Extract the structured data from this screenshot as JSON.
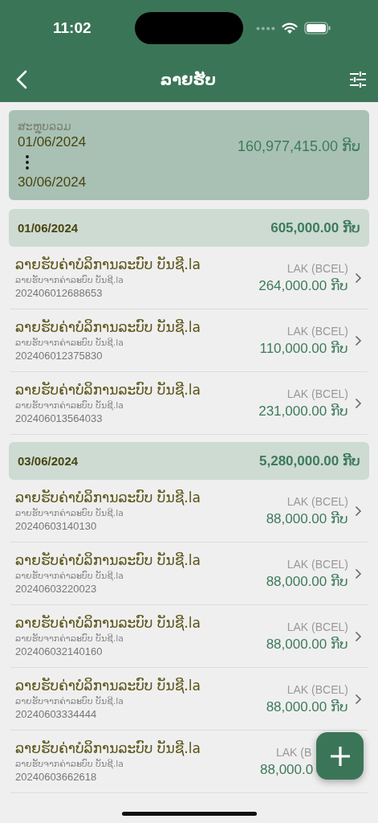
{
  "status_bar": {
    "time": "11:02"
  },
  "nav": {
    "title": "ລາຍຮັບ"
  },
  "summary": {
    "label": "ສະຫຼຸບລວມ",
    "date_from": "01/06/2024",
    "date_to": "30/06/2024",
    "total": "160,977,415.00 ກີບ"
  },
  "groups": [
    {
      "date": "01/06/2024",
      "total": "605,000.00 ກີບ",
      "items": [
        {
          "title": "ລາຍຮັບຄ່າບໍລິການລະບົບ ບັນຊີ.la",
          "subtitle": "ລາຍຮັບຈາກຄ່າລະບົບ ບັນຊີ.la",
          "reference": "202406012688653",
          "currency": "LAK (BCEL)",
          "amount": "264,000.00 ກີບ",
          "chevron": true
        },
        {
          "title": "ລາຍຮັບຄ່າບໍລິການລະບົບ ບັນຊີ.la",
          "subtitle": "ລາຍຮັບຈາກຄ່າລະບົບ ບັນຊີ.la",
          "reference": "202406012375830",
          "currency": "LAK (BCEL)",
          "amount": "110,000.00 ກີບ",
          "chevron": true
        },
        {
          "title": "ລາຍຮັບຄ່າບໍລິການລະບົບ ບັນຊີ.la",
          "subtitle": "ລາຍຮັບຈາກຄ່າລະບົບ ບັນຊີ.la",
          "reference": "202406013564033",
          "currency": "LAK (BCEL)",
          "amount": "231,000.00 ກີບ",
          "chevron": true
        }
      ]
    },
    {
      "date": "03/06/2024",
      "total": "5,280,000.00 ກີບ",
      "items": [
        {
          "title": "ລາຍຮັບຄ່າບໍລິການລະບົບ ບັນຊີ.la",
          "subtitle": "ລາຍຮັບຈາກຄ່າລະບົບ ບັນຊີ.la",
          "reference": "20240603140130",
          "currency": "LAK (BCEL)",
          "amount": "88,000.00 ກີບ",
          "chevron": true
        },
        {
          "title": "ລາຍຮັບຄ່າບໍລິການລະບົບ ບັນຊີ.la",
          "subtitle": "ລາຍຮັບຈາກຄ່າລະບົບ ບັນຊີ.la",
          "reference": "20240603220023",
          "currency": "LAK (BCEL)",
          "amount": "88,000.00 ກີບ",
          "chevron": true
        },
        {
          "title": "ລາຍຮັບຄ່າບໍລິການລະບົບ ບັນຊີ.la",
          "subtitle": "ລາຍຮັບຈາກຄ່າລະບົບ ບັນຊີ.la",
          "reference": "202406032140160",
          "currency": "LAK (BCEL)",
          "amount": "88,000.00 ກີບ",
          "chevron": true
        },
        {
          "title": "ລາຍຮັບຄ່າບໍລິການລະບົບ ບັນຊີ.la",
          "subtitle": "ລາຍຮັບຈາກຄ່າລະບົບ ບັນຊີ.la",
          "reference": "20240603334444",
          "currency": "LAK (BCEL)",
          "amount": "88,000.00 ກີບ",
          "chevron": true
        },
        {
          "title": "ລາຍຮັບຄ່າບໍລິການລະບົບ ບັນຊີ.la",
          "subtitle": "ລາຍຮັບຈາກຄ່າລະບົບ ບັນຊີ.la",
          "reference": "20240603662618",
          "currency": "LAK (B",
          "amount": "88,000.0",
          "chevron": false
        }
      ]
    }
  ]
}
